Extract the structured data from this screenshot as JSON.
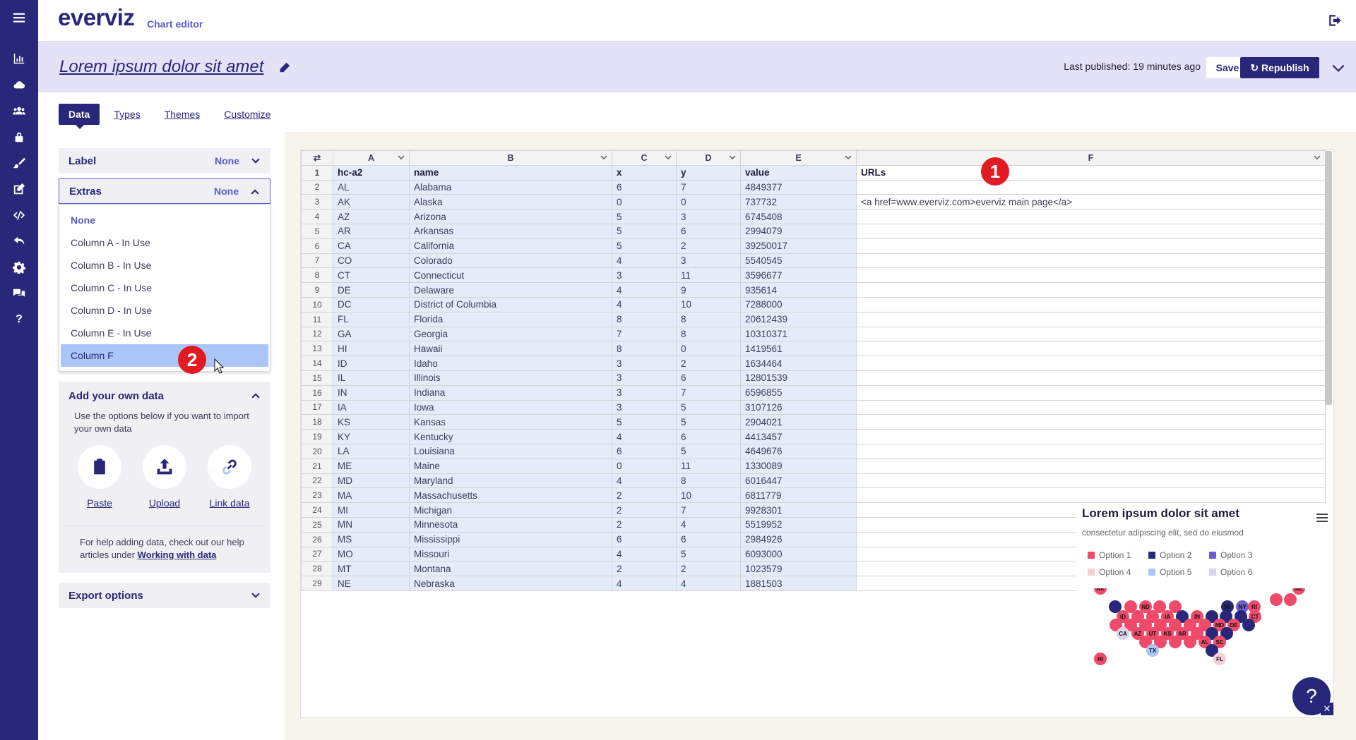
{
  "app": {
    "logo": "everviz",
    "logo_sub": "Chart editor"
  },
  "header": {
    "title": "Lorem ipsum dolor sit amet",
    "last_published": "Last published: 19 minutes ago",
    "save_label": "Save",
    "republish_label": "Republish"
  },
  "tabs": [
    "Data",
    "Types",
    "Themes",
    "Customize"
  ],
  "left_panel": {
    "label": {
      "title": "Label",
      "value": "None"
    },
    "extras": {
      "title": "Extras",
      "value": "None"
    },
    "dropdown_options": [
      "None",
      "Column A - In Use",
      "Column B - In Use",
      "Column C - In Use",
      "Column D - In Use",
      "Column E - In Use",
      "Column F"
    ],
    "selected_option": "Column F",
    "add_own_data": {
      "title": "Add your own data",
      "desc": "Use the options below if you want to import your own data",
      "actions": [
        "Paste",
        "Upload",
        "Link data"
      ],
      "help_prefix": "For help adding data, check out our help articles under",
      "help_link": "Working with data"
    },
    "export": {
      "title": "Export options"
    }
  },
  "annotations": {
    "badge1": "1",
    "badge2": "2"
  },
  "sheet": {
    "columns": [
      "A",
      "B",
      "C",
      "D",
      "E",
      "F"
    ],
    "header_row": [
      "hc-a2",
      "name",
      "x",
      "y",
      "value",
      "URLs"
    ],
    "rows": [
      [
        "AL",
        "Alabama",
        "6",
        "7",
        "4849377",
        ""
      ],
      [
        "AK",
        "Alaska",
        "0",
        "0",
        "737732",
        "<a href=www.everviz.com>everviz main page</a>"
      ],
      [
        "AZ",
        "Arizona",
        "5",
        "3",
        "6745408",
        ""
      ],
      [
        "AR",
        "Arkansas",
        "5",
        "6",
        "2994079",
        ""
      ],
      [
        "CA",
        "California",
        "5",
        "2",
        "39250017",
        ""
      ],
      [
        "CO",
        "Colorado",
        "4",
        "3",
        "5540545",
        ""
      ],
      [
        "CT",
        "Connecticut",
        "3",
        "11",
        "3596677",
        ""
      ],
      [
        "DE",
        "Delaware",
        "4",
        "9",
        "935614",
        ""
      ],
      [
        "DC",
        "District of Columbia",
        "4",
        "10",
        "7288000",
        ""
      ],
      [
        "FL",
        "Florida",
        "8",
        "8",
        "20612439",
        ""
      ],
      [
        "GA",
        "Georgia",
        "7",
        "8",
        "10310371",
        ""
      ],
      [
        "HI",
        "Hawaii",
        "8",
        "0",
        "1419561",
        ""
      ],
      [
        "ID",
        "Idaho",
        "3",
        "2",
        "1634464",
        ""
      ],
      [
        "IL",
        "Illinois",
        "3",
        "6",
        "12801539",
        ""
      ],
      [
        "IN",
        "Indiana",
        "3",
        "7",
        "6596855",
        ""
      ],
      [
        "IA",
        "Iowa",
        "3",
        "5",
        "3107126",
        ""
      ],
      [
        "KS",
        "Kansas",
        "5",
        "5",
        "2904021",
        ""
      ],
      [
        "KY",
        "Kentucky",
        "4",
        "6",
        "4413457",
        ""
      ],
      [
        "LA",
        "Louisiana",
        "6",
        "5",
        "4649676",
        ""
      ],
      [
        "ME",
        "Maine",
        "0",
        "11",
        "1330089",
        ""
      ],
      [
        "MD",
        "Maryland",
        "4",
        "8",
        "6016447",
        ""
      ],
      [
        "MA",
        "Massachusetts",
        "2",
        "10",
        "6811779",
        ""
      ],
      [
        "MI",
        "Michigan",
        "2",
        "7",
        "9928301",
        ""
      ],
      [
        "MN",
        "Minnesota",
        "2",
        "4",
        "5519952",
        ""
      ],
      [
        "MS",
        "Mississippi",
        "6",
        "6",
        "2984926",
        ""
      ],
      [
        "MO",
        "Missouri",
        "4",
        "5",
        "6093000",
        ""
      ],
      [
        "MT",
        "Montana",
        "2",
        "2",
        "1023579",
        ""
      ],
      [
        "NE",
        "Nebraska",
        "4",
        "4",
        "1881503",
        ""
      ]
    ]
  },
  "chart_preview": {
    "title": "Lorem ipsum dolor sit amet",
    "subtitle": "consectetur adipiscing elit, sed do eiusmod",
    "legend": [
      {
        "name": "Option 1",
        "color": "#ef4a6a"
      },
      {
        "name": "Option 2",
        "color": "#28277a"
      },
      {
        "name": "Option 3",
        "color": "#6e5ccc"
      },
      {
        "name": "Option 4",
        "color": "#f7cfd8"
      },
      {
        "name": "Option 5",
        "color": "#a9c6f6"
      },
      {
        "name": "Option 6",
        "color": "#d8d4f0"
      }
    ],
    "labels": [
      "AK",
      "ME",
      "ID",
      "ND",
      "IA",
      "MI",
      "NY",
      "RI",
      "IN",
      "CT",
      "MD",
      "DE",
      "CA",
      "AZ",
      "UT",
      "KS",
      "AR",
      "AL",
      "SC",
      "TX",
      "HI",
      "FL"
    ]
  },
  "help_button": "?"
}
